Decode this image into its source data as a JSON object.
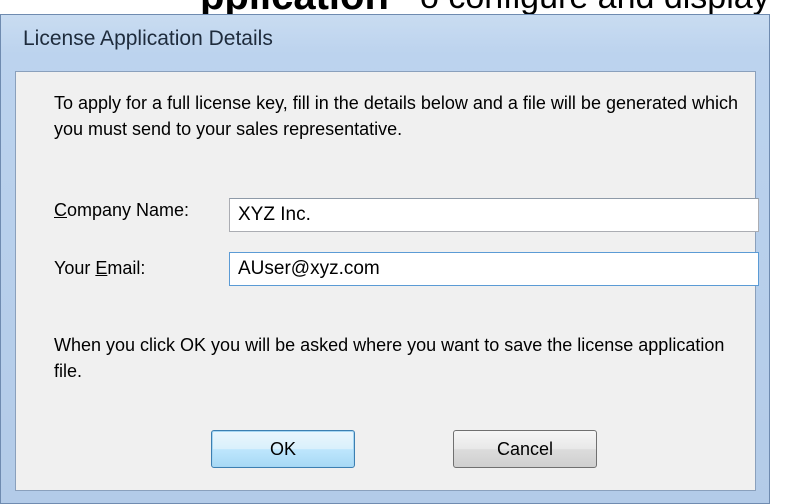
{
  "top_fragment": {
    "text_bold": "pplication",
    "text_regular": "o configure and display"
  },
  "dialog": {
    "title": "License Application Details",
    "intro": "To apply for a full license key, fill in the details below and a file will be generated which you must send to your sales representative.",
    "company_label_underlined": "C",
    "company_label_rest": "ompany Name:",
    "email_label_prefix": "Your ",
    "email_label_underlined": "E",
    "email_label_rest": "mail:",
    "company_value": "XYZ Inc.",
    "email_value": "AUser@xyz.com",
    "note": "When you click OK you will be asked where you want to save the license application file.",
    "ok_label": "OK",
    "cancel_label": "Cancel"
  }
}
